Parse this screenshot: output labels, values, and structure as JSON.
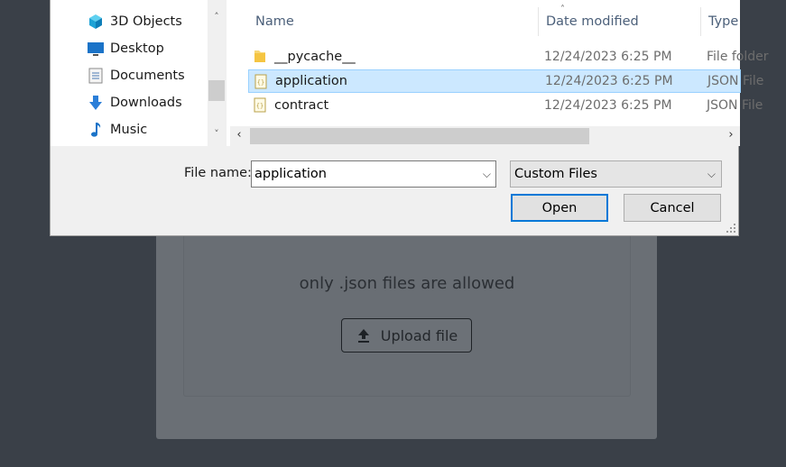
{
  "background_page": {
    "hint": "only .json files are allowed",
    "upload_label": "Upload file"
  },
  "dialog": {
    "nav_items": [
      {
        "label": "3D Objects",
        "icon": "3d-objects-icon"
      },
      {
        "label": "Desktop",
        "icon": "desktop-icon"
      },
      {
        "label": "Documents",
        "icon": "documents-icon"
      },
      {
        "label": "Downloads",
        "icon": "downloads-icon"
      },
      {
        "label": "Music",
        "icon": "music-icon"
      }
    ],
    "columns": {
      "name": "Name",
      "date": "Date modified",
      "type": "Type"
    },
    "files": [
      {
        "name": "__pycache__",
        "date": "12/24/2023 6:25 PM",
        "type": "File folder",
        "icon": "folder-icon"
      },
      {
        "name": "application",
        "date": "12/24/2023 6:25 PM",
        "type": "JSON File",
        "icon": "json-file-icon",
        "selected": true
      },
      {
        "name": "contract",
        "date": "12/24/2023 6:25 PM",
        "type": "JSON File",
        "icon": "json-file-icon"
      }
    ],
    "file_name_label": "File name:",
    "file_name_value": "application",
    "filter_value": "Custom Files",
    "open_label": "Open",
    "cancel_label": "Cancel"
  },
  "colors": {
    "selection": "#cce8ff",
    "accent": "#0078d7",
    "backdrop": "#3a4048"
  }
}
